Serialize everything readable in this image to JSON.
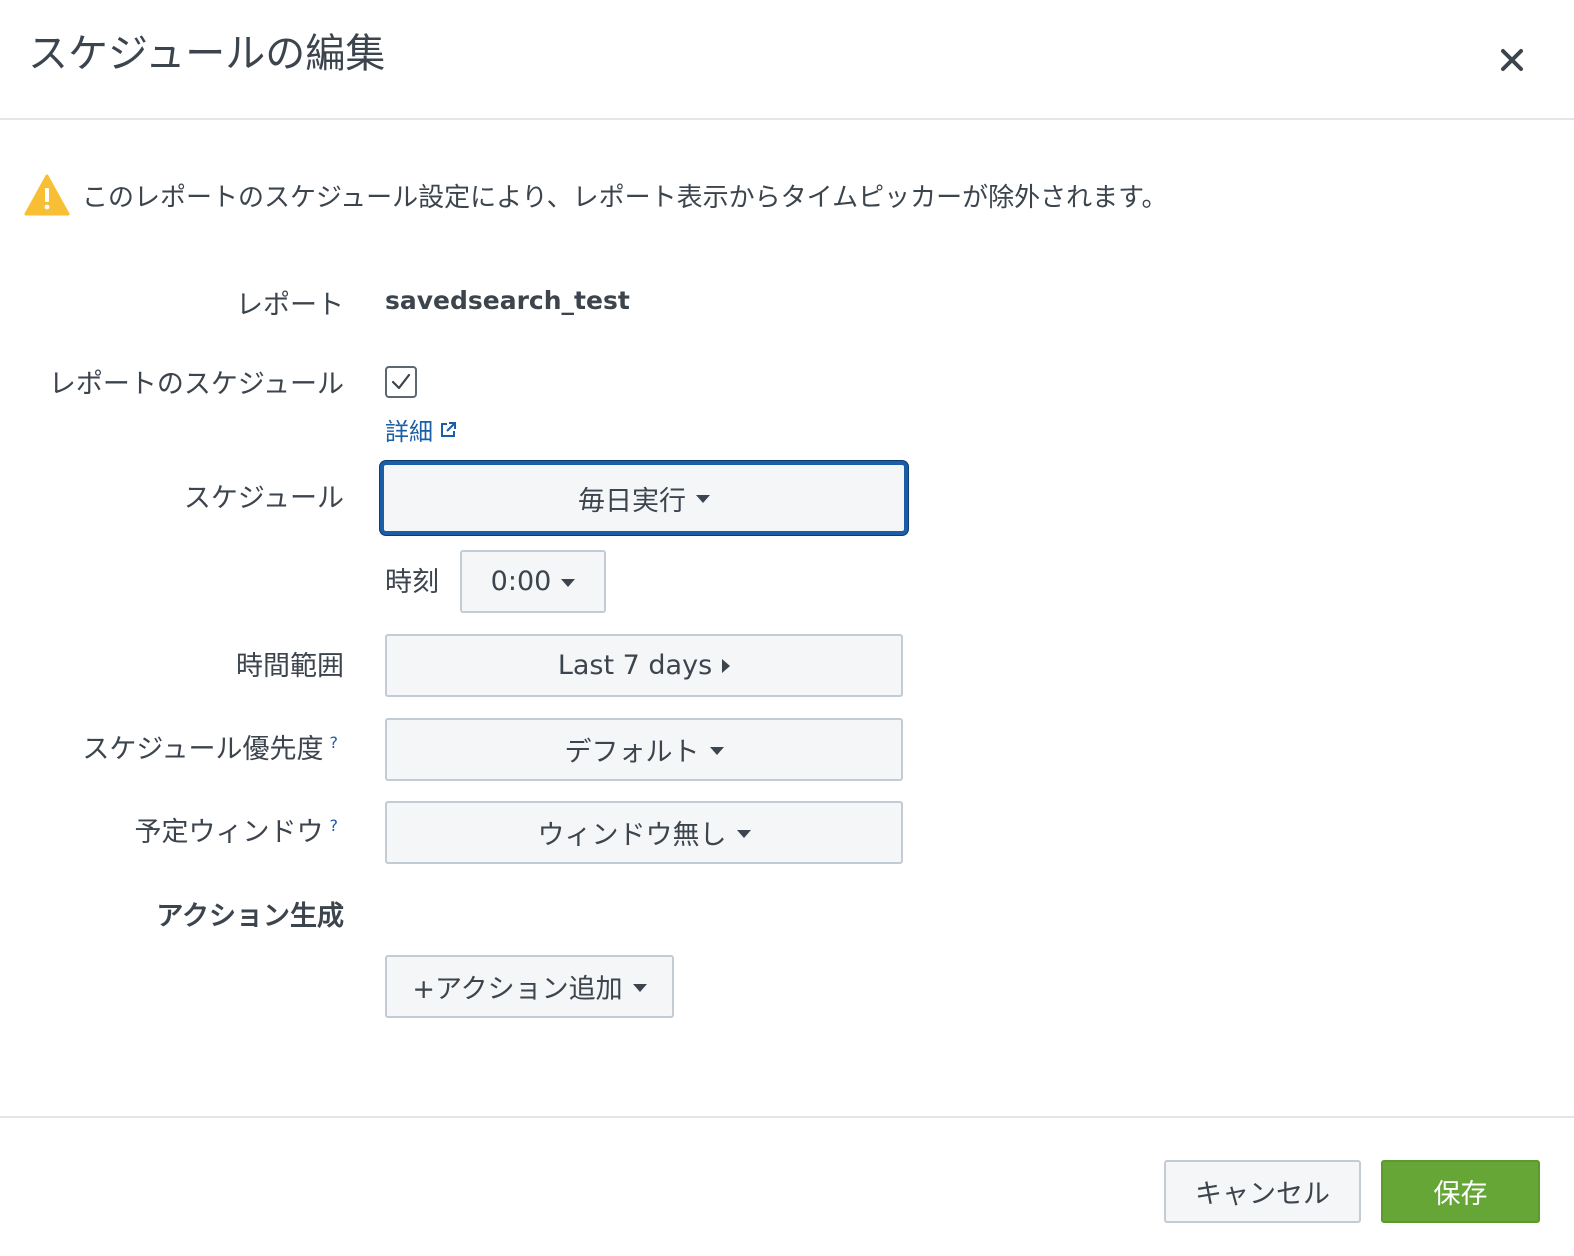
{
  "dialog": {
    "title": "スケジュールの編集",
    "close_icon": "close-icon"
  },
  "warning": {
    "icon": "warning-icon",
    "text": "このレポートのスケジュール設定により、レポート表示からタイムピッカーが除外されます。"
  },
  "form": {
    "report": {
      "label": "レポート",
      "value": "savedsearch_test"
    },
    "schedule_report": {
      "label": "レポートのスケジュール",
      "checked": true,
      "details_link": "詳細",
      "link_icon": "external-link-icon"
    },
    "schedule": {
      "label": "スケジュール",
      "value": "毎日実行",
      "time_label": "時刻",
      "time_value": "0:00"
    },
    "time_range": {
      "label": "時間範囲",
      "value": "Last 7 days"
    },
    "priority": {
      "label": "スケジュール優先度",
      "help": "?",
      "value": "デフォルト"
    },
    "window": {
      "label": "予定ウィンドウ",
      "help": "?",
      "value": "ウィンドウ無し"
    },
    "actions": {
      "label": "アクション生成",
      "add_button": "+アクション追加"
    }
  },
  "footer": {
    "cancel": "キャンセル",
    "save": "保存"
  },
  "colors": {
    "primary_green": "#65a637",
    "link_blue": "#1a5ea8",
    "warning_yellow": "#f8be34",
    "text": "#3c444d"
  }
}
